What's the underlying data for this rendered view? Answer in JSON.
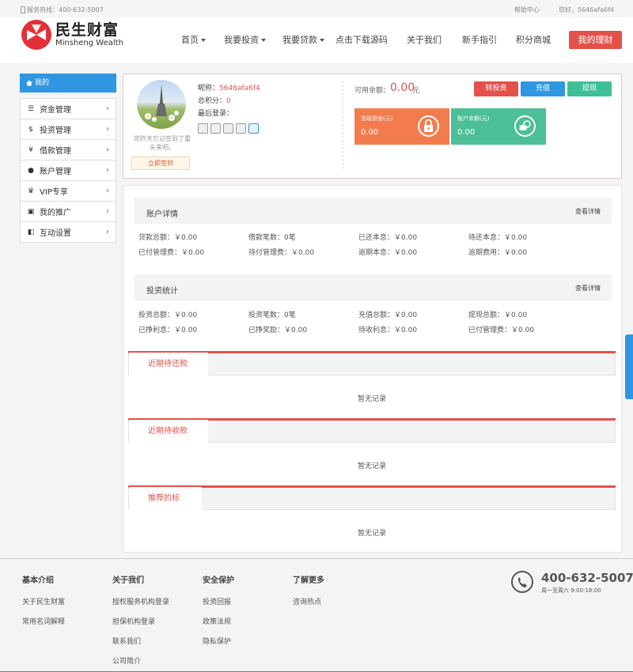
{
  "topbar": {
    "hotline": "服务热线：400-632-5007",
    "help": "帮助中心",
    "greeting": "您好，5646afa6f4"
  },
  "header": {
    "logo_cn": "民生财富",
    "logo_en": "Minsheng Wealth",
    "nav": [
      {
        "label": "首页",
        "caret": true
      },
      {
        "label": "我要投资",
        "caret": true
      },
      {
        "label": "我要贷款",
        "caret": true
      },
      {
        "label": "点击下载源码",
        "caret": false
      },
      {
        "label": "关于我们",
        "caret": false
      },
      {
        "label": "新手指引",
        "caret": false
      },
      {
        "label": "积分商城",
        "caret": false
      }
    ],
    "my_finance": "我的理财",
    "accent": "#e2524a",
    "blue": "#2f97e2"
  },
  "sidebar": {
    "head": "我的",
    "items": [
      {
        "label": "资金管理",
        "icon": "database-icon"
      },
      {
        "label": "投资管理",
        "icon": "moneybag-icon"
      },
      {
        "label": "借款管理",
        "icon": "yen-icon"
      },
      {
        "label": "账户管理",
        "icon": "user-icon"
      },
      {
        "label": "VIP专享",
        "icon": "crown-icon"
      },
      {
        "label": "我的推广",
        "icon": "briefcase-icon"
      },
      {
        "label": "互动设置",
        "icon": "toggle-icon"
      }
    ]
  },
  "user": {
    "checkin_note": "您昨天忘记签到了重头来吧。",
    "checkin_button": "立即签到",
    "nickname_label": "昵称：",
    "nickname": "5646afa6f4",
    "points_label": "总积分：",
    "points": "0",
    "last_login_label": "最后登录：",
    "balance_label": "可用余额：",
    "balance": "0.00",
    "balance_unit": "元",
    "buttons": {
      "transfer": "转投资",
      "recharge": "充值",
      "withdraw": "提现"
    },
    "frozen_label": "冻结资金(元)",
    "frozen_value": "0.00",
    "account_label": "账户余额(元)",
    "account_value": "0.00"
  },
  "account_details": {
    "title": "账户详情",
    "link": "查看详情",
    "rows": [
      [
        "贷款总额：￥0.00",
        "借款笔数：0笔",
        "已还本息：￥0.00",
        "待还本息：￥0.00"
      ],
      [
        "已付管理费：￥0.00",
        "待付管理费：￥0.00",
        "逾期本息：￥0.00",
        "逾期费用：￥0.00"
      ]
    ]
  },
  "investment_stats": {
    "title": "投资统计",
    "link": "查看详情",
    "rows": [
      [
        "投资总额：￥0.00",
        "投资笔数：0笔",
        "充值总额：￥0.00",
        "提现总额：￥0.00"
      ],
      [
        "已挣利息：￥0.00",
        "已挣奖励：￥0.00",
        "待收利息：￥0.00",
        "已付管理费：￥0.00"
      ]
    ]
  },
  "tabs": {
    "repay": "近期待还款",
    "receive": "近期待收款",
    "recommend": "推荐的标",
    "empty": "暂无记录"
  },
  "footer": {
    "col1": {
      "title": "基本介绍",
      "links": [
        "关于民生财富",
        "常用名词解释"
      ]
    },
    "col2": {
      "title": "关于我们",
      "links": [
        "授权服务机构登录",
        "担保机构登录",
        "联系我们",
        "公司简介"
      ]
    },
    "col3": {
      "title": "安全保护",
      "links": [
        "投资回报",
        "政策法规",
        "隐私保护"
      ]
    },
    "col4": {
      "title": "了解更多",
      "links": [
        "咨询热点"
      ]
    },
    "hotline": "400-632-5007",
    "hours": "周一至周六 9:00-18:00"
  }
}
